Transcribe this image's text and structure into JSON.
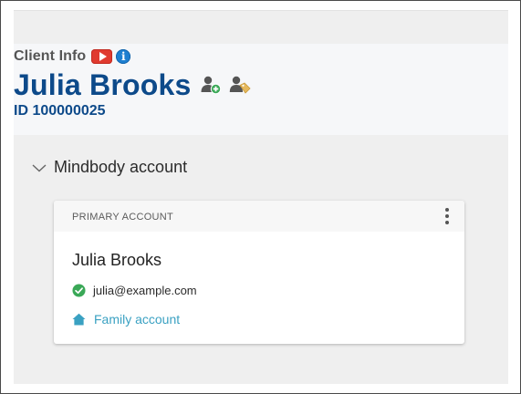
{
  "header": {
    "client_info_label": "Client Info",
    "client_name": "Julia Brooks",
    "client_id": "ID 100000025",
    "icons": {
      "video": "youtube-play-icon",
      "info": "info-icon",
      "info_glyph": "i",
      "add_relationship": "add-relationship-icon",
      "tags": "tag-user-icon"
    }
  },
  "section": {
    "title": "Mindbody account",
    "expanded": true,
    "card": {
      "header_label": "PRIMARY ACCOUNT",
      "name": "Julia Brooks",
      "email": "julia@example.com",
      "email_verified": true,
      "family_link": "Family account"
    }
  },
  "colors": {
    "name_blue": "#0d4a8a",
    "link_teal": "#3aa1c2",
    "verified_green": "#3aa857",
    "youtube_red": "#e03a2f",
    "info_blue": "#1e7fd0"
  }
}
